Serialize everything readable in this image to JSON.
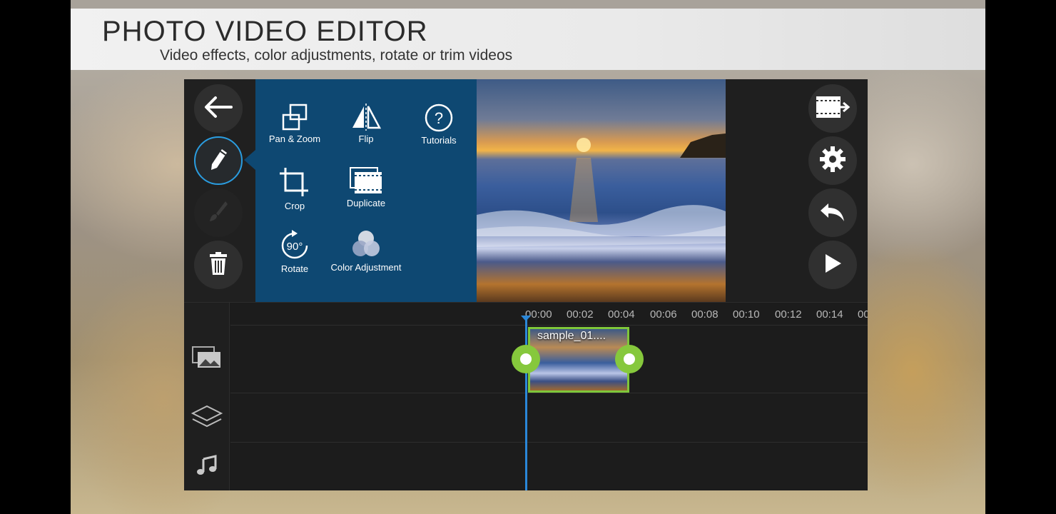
{
  "banner": {
    "title": "PHOTO VIDEO EDITOR",
    "subtitle": "Video effects, color adjustments, rotate or trim videos"
  },
  "left_toolbar": {
    "icons": [
      "back-arrow-icon",
      "pencil-icon",
      "brush-icon",
      "trash-icon"
    ]
  },
  "edit_panel": {
    "tools": [
      {
        "label": "Pan & Zoom",
        "icon": "pan-zoom-icon"
      },
      {
        "label": "Flip",
        "icon": "flip-icon"
      },
      {
        "label": "Tutorials",
        "icon": "help-icon"
      },
      {
        "label": "Crop",
        "icon": "crop-icon"
      },
      {
        "label": "Duplicate",
        "icon": "duplicate-icon"
      },
      {
        "label": "Rotate",
        "icon": "rotate-icon",
        "badge": "90°"
      },
      {
        "label": "Color Adjustment",
        "icon": "color-adjustment-icon"
      }
    ]
  },
  "right_toolbar": {
    "icons": [
      "export-video-icon",
      "settings-gear-icon",
      "undo-icon",
      "play-icon"
    ]
  },
  "timeline": {
    "ticks": [
      "00:00",
      "00:02",
      "00:04",
      "00:06",
      "00:08",
      "00:10",
      "00:12",
      "00:14",
      "00"
    ],
    "clip": {
      "label": "sample_01...."
    },
    "track_icons": [
      "media-track-icon",
      "layers-icon",
      "music-icon"
    ]
  },
  "colors": {
    "accent_blue": "#2a87d8",
    "panel_blue": "#0e4872",
    "clip_green": "#7fc63a"
  }
}
